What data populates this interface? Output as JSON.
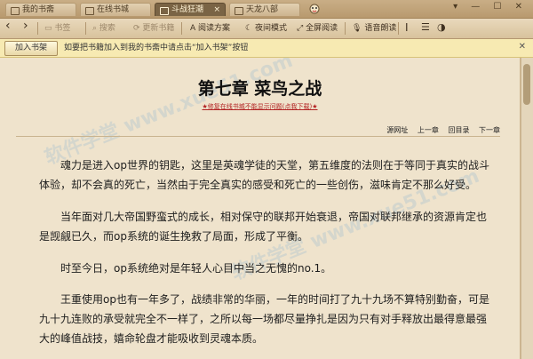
{
  "tabs": [
    {
      "label": "我的书斋",
      "active": false
    },
    {
      "label": "在线书城",
      "active": false
    },
    {
      "label": "斗战狂潮",
      "active": true
    },
    {
      "label": "天龙八部",
      "active": false
    }
  ],
  "toolbar": {
    "back": "‹",
    "forward": "›",
    "bookmark": "书签",
    "search": "搜索",
    "update": "更新书籍",
    "reading_plan": "阅读方案",
    "night_mode": "夜间模式",
    "fullscreen": "全屏阅读",
    "voice": "语音朗读"
  },
  "infobar": {
    "button": "加入书架",
    "message": "如要把书籍加入到我的书斋中请点击“加入书架”按钮"
  },
  "content": {
    "title": "第七章 菜鸟之战",
    "notice": "★修复在线书城不能显示问题(点我下载)★",
    "nav": {
      "source": "源网址",
      "prev": "上一章",
      "toc": "回目录",
      "next": "下一章"
    },
    "paragraphs": [
      "魂力是进入op世界的钥匙，这里是英魂学徒的天堂，第五维度的法则在于等同于真实的战斗体验，却不会真的死亡，当然由于完全真实的感受和死亡的一些创伤，滋味肯定不那么好受。",
      "当年面对几大帝国野蛮式的成长，相对保守的联邦开始衰退，帝国对联邦继承的资源肯定也是觊觎已久，而op系统的诞生挽救了局面，形成了平衡。",
      "时至今日，op系统绝对是年轻人心目中当之无愧的no.1。",
      "王重使用op也有一年多了，战绩非常的华丽，一年的时间打了九十九场不算特别勤奋，可是九十九连败的承受就完全不一样了，之所以每一场都尽量挣扎是因为只有对手释放出最得意最强大的峰值战技，嬉命轮盘才能吸收到灵魂本质。"
    ]
  },
  "watermark": "软件学堂  www.xue51.com",
  "colors": {
    "accent": "#7a6445",
    "notice": "#b22222",
    "page": "#efe3cc"
  }
}
